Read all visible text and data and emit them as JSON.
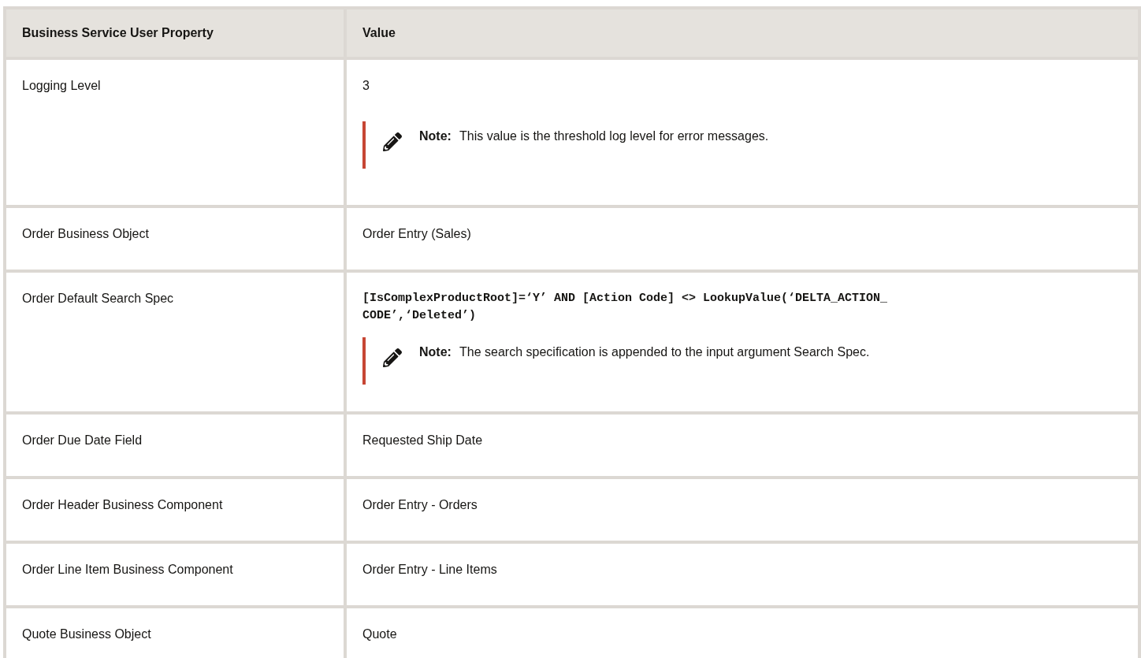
{
  "table": {
    "columns": [
      "Business Service User Property",
      "Value"
    ],
    "rows": [
      {
        "property": "Logging Level",
        "value": {
          "kind": "text",
          "text": "3"
        },
        "note": {
          "label": "Note:",
          "text": "This value is the threshold log level for error messages."
        }
      },
      {
        "property": "Order Business Object",
        "value": {
          "kind": "text",
          "text": "Order Entry (Sales)"
        }
      },
      {
        "property": "Order Default Search Spec",
        "value": {
          "kind": "code",
          "text": "[IsComplexProductRoot]=‘Y’ AND [Action Code] <> LookupValue(‘DELTA_ACTION_\nCODE’,‘Deleted’)"
        },
        "note": {
          "label": "Note:",
          "text": "The search specification is appended to the input argument Search Spec."
        }
      },
      {
        "property": "Order Due Date Field",
        "value": {
          "kind": "text",
          "text": "Requested Ship Date"
        }
      },
      {
        "property": "Order Header Business Component",
        "value": {
          "kind": "text",
          "text": "Order Entry - Orders"
        }
      },
      {
        "property": "Order Line Item Business Component",
        "value": {
          "kind": "text",
          "text": "Order Entry - Line Items"
        }
      },
      {
        "property": "Quote Business Object",
        "value": {
          "kind": "text",
          "text": "Quote"
        }
      }
    ]
  }
}
